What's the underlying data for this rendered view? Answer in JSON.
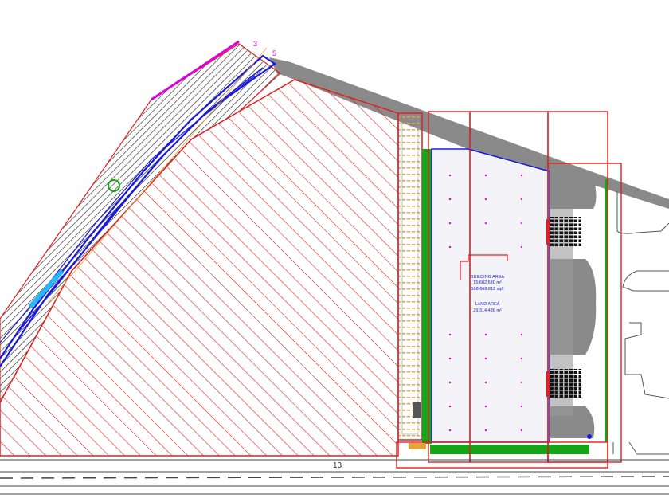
{
  "plan": {
    "marker_top_left": "3",
    "marker_top_right": "5",
    "road_label": "13",
    "building": {
      "area_title": "BUILDING AREA",
      "area_m2": "15,602.630 m²",
      "area_sqft": "168,668.812 sqft",
      "land_title": "LAND AREA",
      "land_m2": "29,314.436 m²"
    }
  },
  "colors": {
    "hatch_red": "#e02020",
    "strip_green": "#16a516",
    "route_blue": "#1a1adc",
    "paving_gray": "#8a8a8a",
    "boundary_magenta": "#e000e0",
    "parking_orange": "#e6a23c"
  }
}
